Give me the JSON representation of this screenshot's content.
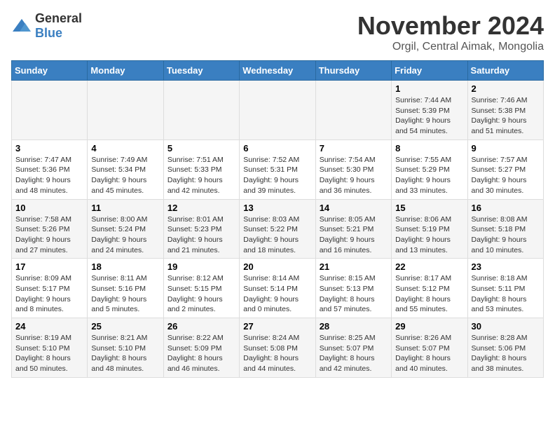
{
  "logo": {
    "general": "General",
    "blue": "Blue"
  },
  "header": {
    "month": "November 2024",
    "location": "Orgil, Central Aimak, Mongolia"
  },
  "weekdays": [
    "Sunday",
    "Monday",
    "Tuesday",
    "Wednesday",
    "Thursday",
    "Friday",
    "Saturday"
  ],
  "weeks": [
    [
      {
        "day": "",
        "sunrise": "",
        "sunset": "",
        "daylight": ""
      },
      {
        "day": "",
        "sunrise": "",
        "sunset": "",
        "daylight": ""
      },
      {
        "day": "",
        "sunrise": "",
        "sunset": "",
        "daylight": ""
      },
      {
        "day": "",
        "sunrise": "",
        "sunset": "",
        "daylight": ""
      },
      {
        "day": "",
        "sunrise": "",
        "sunset": "",
        "daylight": ""
      },
      {
        "day": "1",
        "sunrise": "Sunrise: 7:44 AM",
        "sunset": "Sunset: 5:39 PM",
        "daylight": "Daylight: 9 hours and 54 minutes."
      },
      {
        "day": "2",
        "sunrise": "Sunrise: 7:46 AM",
        "sunset": "Sunset: 5:38 PM",
        "daylight": "Daylight: 9 hours and 51 minutes."
      }
    ],
    [
      {
        "day": "3",
        "sunrise": "Sunrise: 7:47 AM",
        "sunset": "Sunset: 5:36 PM",
        "daylight": "Daylight: 9 hours and 48 minutes."
      },
      {
        "day": "4",
        "sunrise": "Sunrise: 7:49 AM",
        "sunset": "Sunset: 5:34 PM",
        "daylight": "Daylight: 9 hours and 45 minutes."
      },
      {
        "day": "5",
        "sunrise": "Sunrise: 7:51 AM",
        "sunset": "Sunset: 5:33 PM",
        "daylight": "Daylight: 9 hours and 42 minutes."
      },
      {
        "day": "6",
        "sunrise": "Sunrise: 7:52 AM",
        "sunset": "Sunset: 5:31 PM",
        "daylight": "Daylight: 9 hours and 39 minutes."
      },
      {
        "day": "7",
        "sunrise": "Sunrise: 7:54 AM",
        "sunset": "Sunset: 5:30 PM",
        "daylight": "Daylight: 9 hours and 36 minutes."
      },
      {
        "day": "8",
        "sunrise": "Sunrise: 7:55 AM",
        "sunset": "Sunset: 5:29 PM",
        "daylight": "Daylight: 9 hours and 33 minutes."
      },
      {
        "day": "9",
        "sunrise": "Sunrise: 7:57 AM",
        "sunset": "Sunset: 5:27 PM",
        "daylight": "Daylight: 9 hours and 30 minutes."
      }
    ],
    [
      {
        "day": "10",
        "sunrise": "Sunrise: 7:58 AM",
        "sunset": "Sunset: 5:26 PM",
        "daylight": "Daylight: 9 hours and 27 minutes."
      },
      {
        "day": "11",
        "sunrise": "Sunrise: 8:00 AM",
        "sunset": "Sunset: 5:24 PM",
        "daylight": "Daylight: 9 hours and 24 minutes."
      },
      {
        "day": "12",
        "sunrise": "Sunrise: 8:01 AM",
        "sunset": "Sunset: 5:23 PM",
        "daylight": "Daylight: 9 hours and 21 minutes."
      },
      {
        "day": "13",
        "sunrise": "Sunrise: 8:03 AM",
        "sunset": "Sunset: 5:22 PM",
        "daylight": "Daylight: 9 hours and 18 minutes."
      },
      {
        "day": "14",
        "sunrise": "Sunrise: 8:05 AM",
        "sunset": "Sunset: 5:21 PM",
        "daylight": "Daylight: 9 hours and 16 minutes."
      },
      {
        "day": "15",
        "sunrise": "Sunrise: 8:06 AM",
        "sunset": "Sunset: 5:19 PM",
        "daylight": "Daylight: 9 hours and 13 minutes."
      },
      {
        "day": "16",
        "sunrise": "Sunrise: 8:08 AM",
        "sunset": "Sunset: 5:18 PM",
        "daylight": "Daylight: 9 hours and 10 minutes."
      }
    ],
    [
      {
        "day": "17",
        "sunrise": "Sunrise: 8:09 AM",
        "sunset": "Sunset: 5:17 PM",
        "daylight": "Daylight: 9 hours and 8 minutes."
      },
      {
        "day": "18",
        "sunrise": "Sunrise: 8:11 AM",
        "sunset": "Sunset: 5:16 PM",
        "daylight": "Daylight: 9 hours and 5 minutes."
      },
      {
        "day": "19",
        "sunrise": "Sunrise: 8:12 AM",
        "sunset": "Sunset: 5:15 PM",
        "daylight": "Daylight: 9 hours and 2 minutes."
      },
      {
        "day": "20",
        "sunrise": "Sunrise: 8:14 AM",
        "sunset": "Sunset: 5:14 PM",
        "daylight": "Daylight: 9 hours and 0 minutes."
      },
      {
        "day": "21",
        "sunrise": "Sunrise: 8:15 AM",
        "sunset": "Sunset: 5:13 PM",
        "daylight": "Daylight: 8 hours and 57 minutes."
      },
      {
        "day": "22",
        "sunrise": "Sunrise: 8:17 AM",
        "sunset": "Sunset: 5:12 PM",
        "daylight": "Daylight: 8 hours and 55 minutes."
      },
      {
        "day": "23",
        "sunrise": "Sunrise: 8:18 AM",
        "sunset": "Sunset: 5:11 PM",
        "daylight": "Daylight: 8 hours and 53 minutes."
      }
    ],
    [
      {
        "day": "24",
        "sunrise": "Sunrise: 8:19 AM",
        "sunset": "Sunset: 5:10 PM",
        "daylight": "Daylight: 8 hours and 50 minutes."
      },
      {
        "day": "25",
        "sunrise": "Sunrise: 8:21 AM",
        "sunset": "Sunset: 5:10 PM",
        "daylight": "Daylight: 8 hours and 48 minutes."
      },
      {
        "day": "26",
        "sunrise": "Sunrise: 8:22 AM",
        "sunset": "Sunset: 5:09 PM",
        "daylight": "Daylight: 8 hours and 46 minutes."
      },
      {
        "day": "27",
        "sunrise": "Sunrise: 8:24 AM",
        "sunset": "Sunset: 5:08 PM",
        "daylight": "Daylight: 8 hours and 44 minutes."
      },
      {
        "day": "28",
        "sunrise": "Sunrise: 8:25 AM",
        "sunset": "Sunset: 5:07 PM",
        "daylight": "Daylight: 8 hours and 42 minutes."
      },
      {
        "day": "29",
        "sunrise": "Sunrise: 8:26 AM",
        "sunset": "Sunset: 5:07 PM",
        "daylight": "Daylight: 8 hours and 40 minutes."
      },
      {
        "day": "30",
        "sunrise": "Sunrise: 8:28 AM",
        "sunset": "Sunset: 5:06 PM",
        "daylight": "Daylight: 8 hours and 38 minutes."
      }
    ]
  ]
}
